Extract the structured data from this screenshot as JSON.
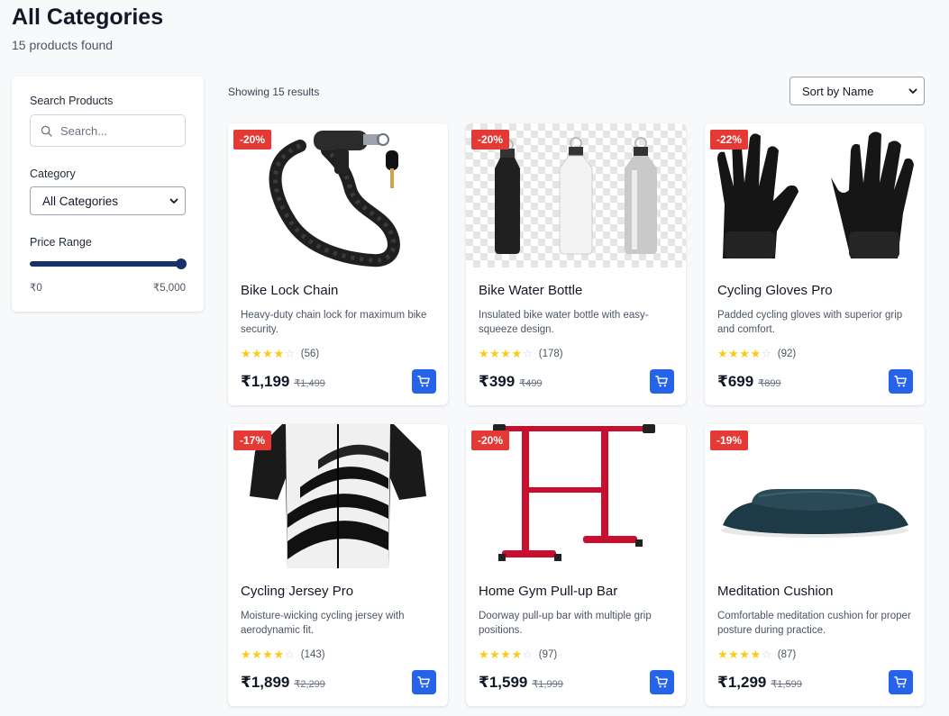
{
  "header": {
    "title": "All Categories",
    "subtitle": "15 products found"
  },
  "sidebar": {
    "search_label": "Search Products",
    "search_placeholder": "Search...",
    "category_label": "Category",
    "category_value": "All Categories",
    "price_label": "Price Range",
    "price_min": "₹0",
    "price_max": "₹5,000",
    "price_level_fraction": 1.0
  },
  "toolbar": {
    "results_text": "Showing 15 results",
    "sort_value": "Sort by Name"
  },
  "colors": {
    "badge": "#e53935",
    "cart": "#2563eb",
    "slider": "#17326b",
    "star": "#facc15"
  },
  "products": [
    {
      "name": "Bike Lock Chain",
      "description": "Heavy-duty chain lock for maximum bike security.",
      "discount": "-20%",
      "rating_count": "(56)",
      "stars": 4,
      "price": "₹1,199",
      "old_price": "₹1,499"
    },
    {
      "name": "Bike Water Bottle",
      "description": "Insulated bike water bottle with easy-squeeze design.",
      "discount": "-20%",
      "rating_count": "(178)",
      "stars": 4,
      "price": "₹399",
      "old_price": "₹499"
    },
    {
      "name": "Cycling Gloves Pro",
      "description": "Padded cycling gloves with superior grip and comfort.",
      "discount": "-22%",
      "rating_count": "(92)",
      "stars": 4,
      "price": "₹699",
      "old_price": "₹899"
    },
    {
      "name": "Cycling Jersey Pro",
      "description": "Moisture-wicking cycling jersey with aerodynamic fit.",
      "discount": "-17%",
      "rating_count": "(143)",
      "stars": 4,
      "price": "₹1,899",
      "old_price": "₹2,299"
    },
    {
      "name": "Home Gym Pull-up Bar",
      "description": "Doorway pull-up bar with multiple grip positions.",
      "discount": "-20%",
      "rating_count": "(97)",
      "stars": 4,
      "price": "₹1,599",
      "old_price": "₹1,999"
    },
    {
      "name": "Meditation Cushion",
      "description": "Comfortable meditation cushion for proper posture during practice.",
      "discount": "-19%",
      "rating_count": "(87)",
      "stars": 4,
      "price": "₹1,299",
      "old_price": "₹1,599"
    }
  ]
}
